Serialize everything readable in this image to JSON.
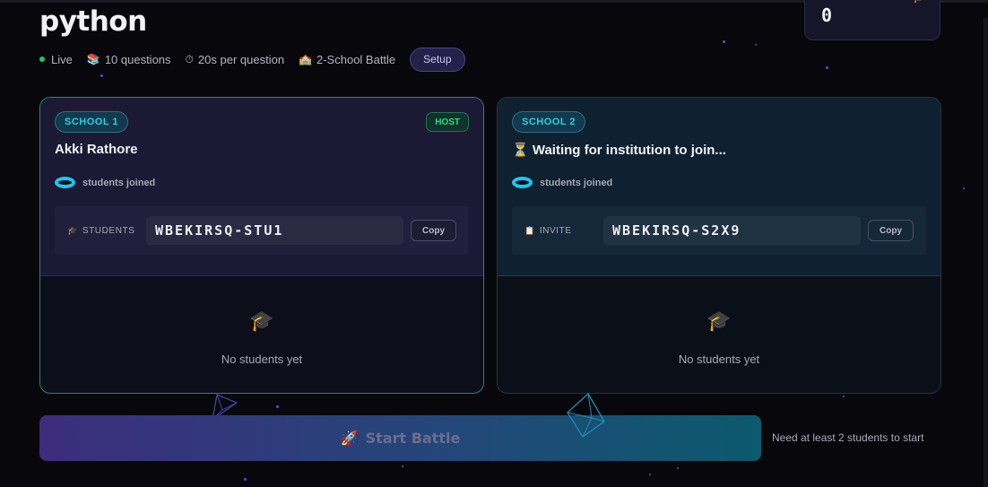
{
  "header": {
    "title": "python",
    "meta": {
      "live": "Live",
      "questions": "10 questions",
      "time": "20s per question",
      "mode": "2-School Battle",
      "setup_label": "Setup"
    },
    "score": "0"
  },
  "schools": [
    {
      "badge": "SCHOOL 1",
      "host_badge": "HOST",
      "name": "Akki Rathore",
      "joined_label": "students joined",
      "code_label": "STUDENTS",
      "code": "WBEKIRSQ-STU1",
      "copy_label": "Copy",
      "empty_text": "No students yet"
    },
    {
      "badge": "SCHOOL 2",
      "name": "⏳ Waiting for institution to join...",
      "joined_label": "students joined",
      "code_label": "INVITE",
      "code": "WBEKIRSQ-S2X9",
      "copy_label": "Copy",
      "empty_text": "No students yet"
    }
  ],
  "footer": {
    "start_label": "Start Battle",
    "hint": "Need at least 2 students to start"
  },
  "icons": {
    "questions": "books-icon",
    "time": "stopwatch-icon",
    "mode": "school-icon",
    "students_code": "graduation-cap-icon",
    "invite_code": "clipboard-icon",
    "empty": "graduation-cap-icon",
    "start": "rocket-icon"
  },
  "colors": {
    "accent_cyan": "#1ec6f0",
    "host_green": "#22d98e",
    "live_green": "#22c55e"
  }
}
